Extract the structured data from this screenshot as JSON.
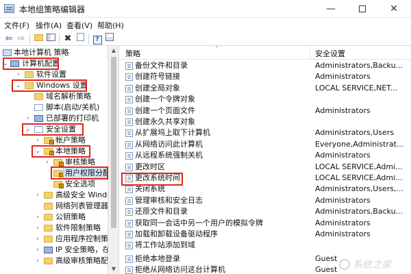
{
  "window": {
    "title": "本地组策略编辑器"
  },
  "menu": [
    "文件(F)",
    "操作(A)",
    "查看(V)",
    "帮助(H)"
  ],
  "tree": [
    {
      "label": "本地计算机 策略",
      "toggle": ""
    },
    {
      "label": "计算机配置",
      "toggle": "⌄"
    },
    {
      "label": "软件设置",
      "toggle": "›"
    },
    {
      "label": "Windows 设置",
      "toggle": "⌄"
    },
    {
      "label": "域名解析策略",
      "toggle": ""
    },
    {
      "label": "脚本(启动/关机)",
      "toggle": ""
    },
    {
      "label": "已部署的打印机",
      "toggle": "›"
    },
    {
      "label": "安全设置",
      "toggle": "⌄"
    },
    {
      "label": "帐户策略",
      "toggle": "›"
    },
    {
      "label": "本地策略",
      "toggle": "⌄"
    },
    {
      "label": "审核策略",
      "toggle": "›"
    },
    {
      "label": "用户权限分配",
      "toggle": ""
    },
    {
      "label": "安全选项",
      "toggle": ""
    },
    {
      "label": "高级安全 Window",
      "toggle": "›"
    },
    {
      "label": "网络列表管理器",
      "toggle": ""
    },
    {
      "label": "公钥策略",
      "toggle": "›"
    },
    {
      "label": "软件限制策略",
      "toggle": "›"
    },
    {
      "label": "应用程序控制策略",
      "toggle": "›"
    },
    {
      "label": "IP 安全策略，在",
      "toggle": "›"
    },
    {
      "label": "高级审核策略配置",
      "toggle": "›"
    }
  ],
  "columns": {
    "policy": "策略",
    "setting": "安全设置"
  },
  "policies": [
    {
      "name": "备份文件和目录",
      "value": "Administrators,Backu..."
    },
    {
      "name": "创建符号链接",
      "value": "Administrators"
    },
    {
      "name": "创建全局对象",
      "value": "LOCAL SERVICE,NET..."
    },
    {
      "name": "创建一个令牌对象",
      "value": ""
    },
    {
      "name": "创建一个页面文件",
      "value": "Administrators"
    },
    {
      "name": "创建永久共享对象",
      "value": ""
    },
    {
      "name": "从扩展坞上取下计算机",
      "value": "Administrators,Users"
    },
    {
      "name": "从网络访问此计算机",
      "value": "Everyone,Administrat..."
    },
    {
      "name": "从远程系统强制关机",
      "value": "Administrators"
    },
    {
      "name": "更改时区",
      "value": "LOCAL SERVICE,Admi..."
    },
    {
      "name": "更改系统时间",
      "value": "LOCAL SERVICE,Admi..."
    },
    {
      "name": "关闭系统",
      "value": "Administrators,Users,..."
    },
    {
      "name": "管理审核和安全日志",
      "value": "Administrators"
    },
    {
      "name": "还原文件和目录",
      "value": "Administrators,Backu..."
    },
    {
      "name": "获取同一会话中另一个用户的模拟令牌",
      "value": "Administrators"
    },
    {
      "name": "加载和卸载设备驱动程序",
      "value": "Administrators"
    },
    {
      "name": "将工作站添加到域",
      "value": ""
    },
    {
      "name": "拒绝本地登录",
      "value": "Guest"
    },
    {
      "name": "拒绝从网络访问这台计算机",
      "value": "Guest"
    }
  ],
  "watermark": "系统之家"
}
